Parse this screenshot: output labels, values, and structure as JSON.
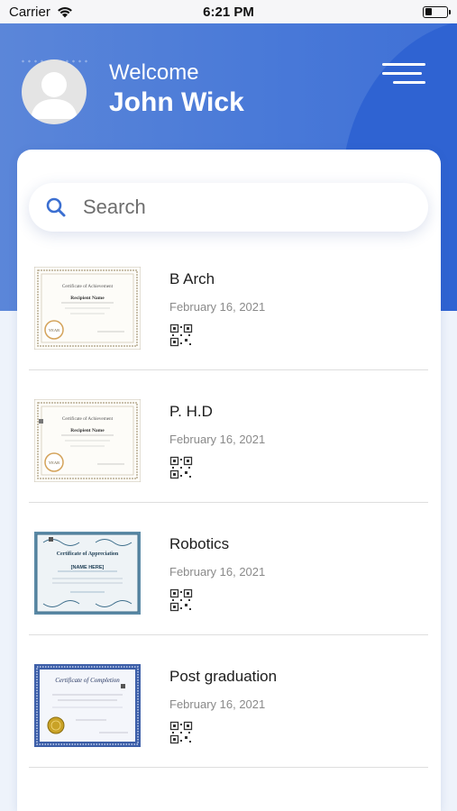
{
  "status_bar": {
    "carrier": "Carrier",
    "time": "6:21 PM"
  },
  "header": {
    "welcome": "Welcome",
    "user_name": "John Wick"
  },
  "search": {
    "placeholder": "Search",
    "value": ""
  },
  "items": [
    {
      "title": "B Arch",
      "date": "February 16, 2021",
      "certificate": "Certificate of Achievement",
      "recipient": "Recipient Name",
      "badge": "YEAR"
    },
    {
      "title": "P. H.D",
      "date": "February 16, 2021",
      "certificate": "Certificate of Achievement",
      "recipient": "Recipient Name",
      "badge": "YEAR"
    },
    {
      "title": "Robotics",
      "date": "February 16, 2021",
      "certificate": "Certificate of Appreciation",
      "recipient": "[NAME HERE]"
    },
    {
      "title": "Post graduation",
      "date": "February 16, 2021",
      "certificate": "Certificate of Completion"
    }
  ],
  "colors": {
    "header_blue": "#4a7ad8",
    "accent_blue": "#2f63d2",
    "search_icon": "#3b6fd1"
  }
}
